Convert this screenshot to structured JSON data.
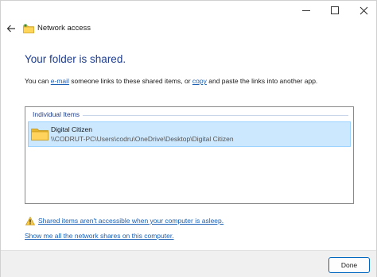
{
  "window": {
    "title": "Network access"
  },
  "main": {
    "headline": "Your folder is shared.",
    "desc_prefix": "You can ",
    "email_link": "e-mail",
    "desc_middle": " someone links to these shared items, or ",
    "copy_link": "copy",
    "desc_suffix": " and paste the links into another app."
  },
  "list": {
    "group_header": "Individual Items",
    "items": [
      {
        "name": "Digital Citizen",
        "path": "\\\\CODRUT-PC\\Users\\codru\\OneDrive\\Desktop\\Digital Citizen"
      }
    ]
  },
  "links": {
    "warning": "Shared items aren't accessible when your computer is asleep.",
    "show_shares": "Show me all the network shares on this computer."
  },
  "footer": {
    "done_label": "Done"
  },
  "icons": {
    "back": "back-arrow-icon",
    "title": "network-folder-icon",
    "folder": "folder-icon",
    "warning": "warning-icon"
  },
  "colors": {
    "headline": "#1e3d8f",
    "link": "#1a5fb4",
    "selection": "#cce8ff",
    "accent": "#0067c0"
  }
}
